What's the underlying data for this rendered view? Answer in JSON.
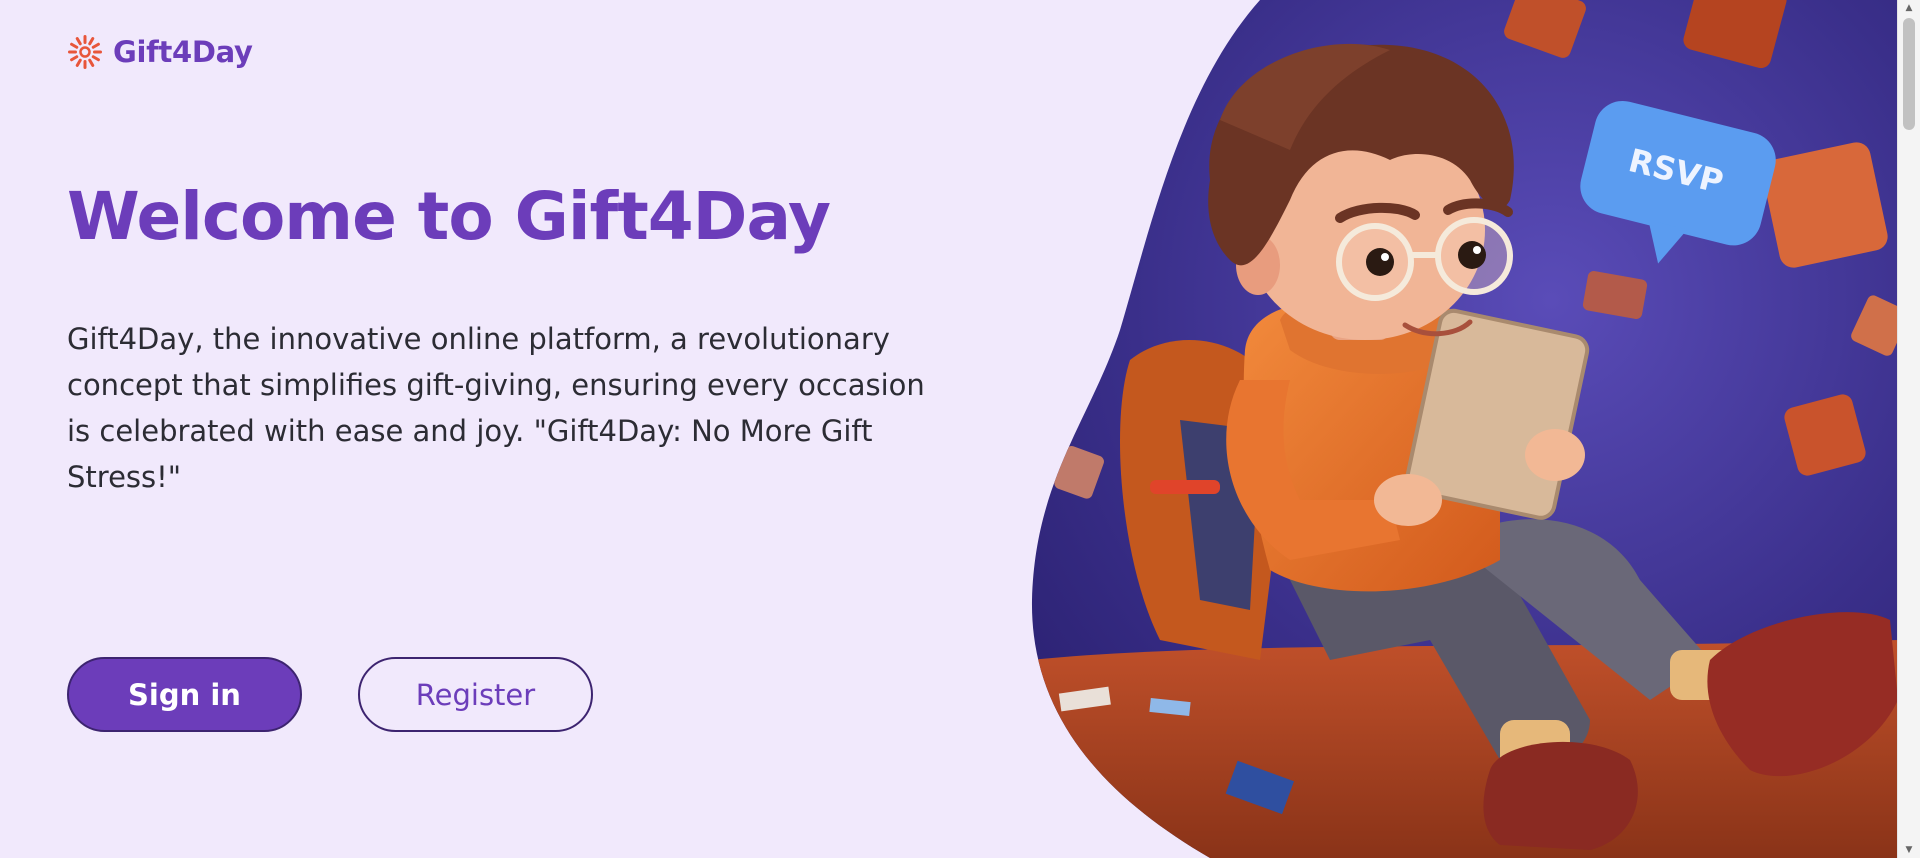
{
  "brand": {
    "name": "Gift4Day",
    "logo_icon": "sunburst-logo-icon",
    "logo_color": "#e8553a"
  },
  "hero": {
    "title": "Welcome to Gift4Day",
    "description": "Gift4Day, the innovative online platform, a revolutionary concept that simplifies gift-giving, ensuring every occasion is celebrated with ease and joy. \"Gift4Day: No More Gift Stress!\""
  },
  "actions": {
    "signin_label": "Sign in",
    "register_label": "Register"
  },
  "illustration": {
    "speech_bubble_text": "RSVP"
  },
  "colors": {
    "background": "#f1e9fc",
    "primary": "#6c3dba",
    "text": "#2c2c34",
    "illustration_bg": "#3a2f8a",
    "accent_orange": "#e86a2b",
    "bubble_blue": "#5b9cf0"
  }
}
